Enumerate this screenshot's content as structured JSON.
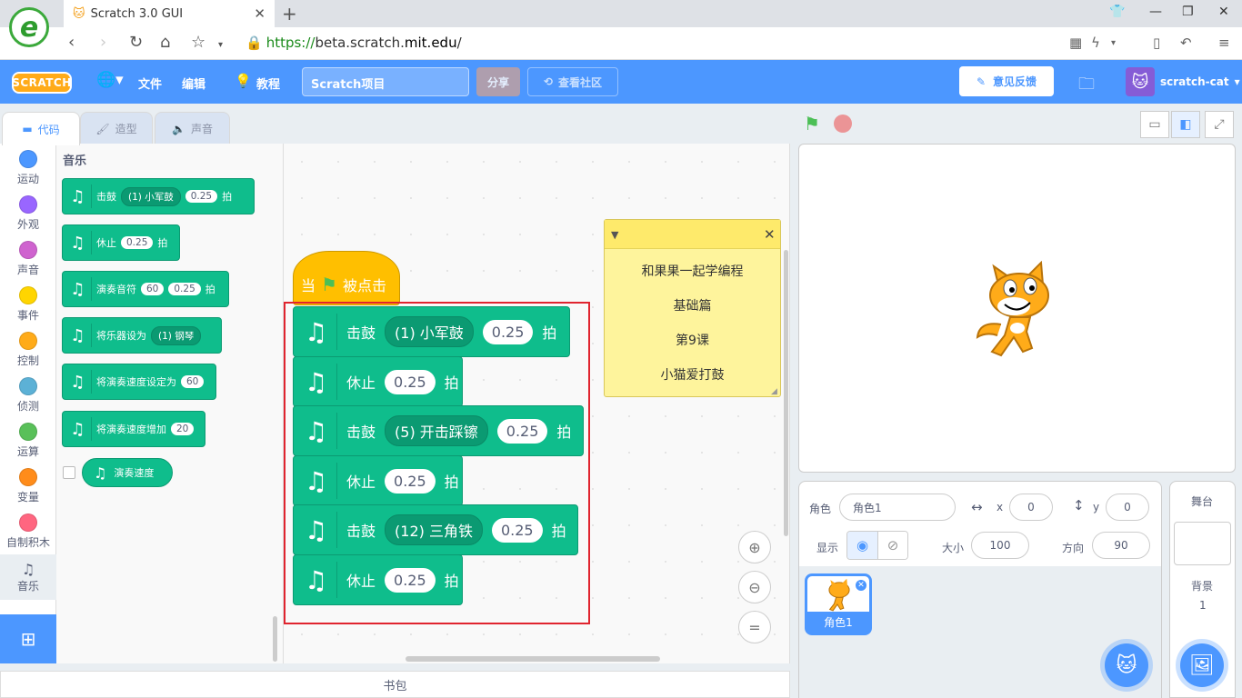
{
  "browser": {
    "tab_title": "Scratch 3.0 GUI",
    "url_scheme": "https://",
    "url_sub": "beta.scratch.",
    "url_domain": "mit.edu",
    "url_path": "/",
    "logo_letter": "e"
  },
  "menu": {
    "logo": "SCRATCH",
    "file": "文件",
    "edit": "编辑",
    "tutorials": "教程",
    "project_title": "Scratch项目",
    "share": "分享",
    "see_community": "查看社区",
    "feedback": "意见反馈",
    "username": "scratch-cat"
  },
  "editor_tabs": {
    "code": "代码",
    "costumes": "造型",
    "sounds": "声音"
  },
  "categories": [
    {
      "label": "运动",
      "color": "#4c97ff"
    },
    {
      "label": "外观",
      "color": "#9966ff"
    },
    {
      "label": "声音",
      "color": "#cf63cf"
    },
    {
      "label": "事件",
      "color": "#ffd500"
    },
    {
      "label": "控制",
      "color": "#ffab19"
    },
    {
      "label": "侦测",
      "color": "#5cb1d6"
    },
    {
      "label": "运算",
      "color": "#59c059"
    },
    {
      "label": "变量",
      "color": "#ff8c1a"
    },
    {
      "label": "自制积木",
      "color": "#ff6680"
    },
    {
      "label": "音乐",
      "color": "#0fbd8c"
    }
  ],
  "palette": {
    "title": "音乐",
    "b1": {
      "text": "击鼓",
      "drum": "(1) 小军鼓",
      "beats": "0.25",
      "unit": "拍"
    },
    "b2": {
      "text": "休止",
      "beats": "0.25",
      "unit": "拍"
    },
    "b3": {
      "text": "演奏音符",
      "note": "60",
      "beats": "0.25",
      "unit": "拍"
    },
    "b4": {
      "text": "将乐器设为",
      "instrument": "(1) 钢琴"
    },
    "b5": {
      "text": "将演奏速度设定为",
      "value": "60"
    },
    "b6": {
      "text": "将演奏速度增加",
      "value": "20"
    },
    "b7": {
      "text": "演奏速度"
    }
  },
  "script": {
    "hat_when": "当",
    "hat_clicked": "被点击",
    "s1": {
      "text": "击鼓",
      "drum": "(1) 小军鼓",
      "beats": "0.25",
      "unit": "拍"
    },
    "s2": {
      "text": "休止",
      "beats": "0.25",
      "unit": "拍"
    },
    "s3": {
      "text": "击鼓",
      "drum": "(5) 开击踩镲",
      "beats": "0.25",
      "unit": "拍"
    },
    "s4": {
      "text": "休止",
      "beats": "0.25",
      "unit": "拍"
    },
    "s5": {
      "text": "击鼓",
      "drum": "(12) 三角铁",
      "beats": "0.25",
      "unit": "拍"
    },
    "s6": {
      "text": "休止",
      "beats": "0.25",
      "unit": "拍"
    }
  },
  "note": {
    "line1": "和果果一起学编程",
    "line2": "基础篇",
    "line3": "第9课",
    "line4": "小猫爱打鼓"
  },
  "backpack": "书包",
  "sprite_info": {
    "sprite_label": "角色",
    "sprite_name": "角色1",
    "x_label": "x",
    "x": "0",
    "y_label": "y",
    "y": "0",
    "show_label": "显示",
    "size_label": "大小",
    "size": "100",
    "direction_label": "方向",
    "direction": "90"
  },
  "sprite_list": [
    {
      "name": "角色1"
    }
  ],
  "stage_pane": {
    "title": "舞台",
    "backdrop_label": "背景",
    "backdrop_count": "1"
  },
  "colors": {
    "accent": "#4c97ff",
    "music_block": "#0fbd8c",
    "event_block": "#ffbf00",
    "highlight_box": "#e0242f",
    "note_bg": "#fef49c"
  }
}
